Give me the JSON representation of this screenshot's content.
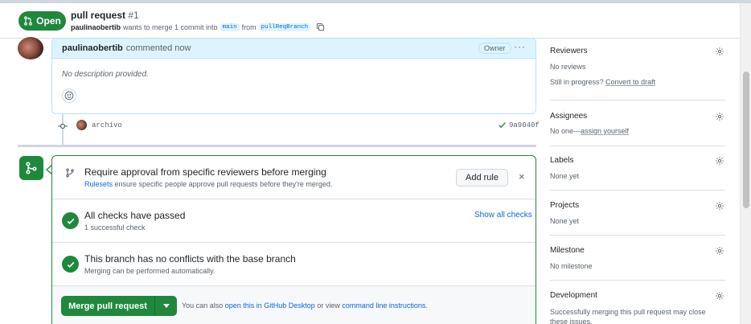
{
  "header": {
    "state": "Open",
    "title": "pull request",
    "number": "#1",
    "author": "paulinaobertib",
    "merge_text": "wants to merge 1 commit into",
    "base_branch": "main",
    "from_text": "from",
    "head_branch": "pullReqBranch"
  },
  "comment": {
    "author": "paulinaobertib",
    "action": "commented now",
    "badge": "Owner",
    "menu": "···",
    "body": "No description provided."
  },
  "commit": {
    "message": "archivo",
    "sha": "9a9040f"
  },
  "merge_box": {
    "rules": {
      "title": "Require approval from specific reviewers before merging",
      "link": "Rulesets",
      "description": "ensure specific people approve pull requests before they're merged.",
      "button": "Add rule",
      "close": "×"
    },
    "checks": {
      "title": "All checks have passed",
      "subtitle": "1 successful check",
      "link": "Show all checks"
    },
    "conflicts": {
      "title": "This branch has no conflicts with the base branch",
      "subtitle": "Merging can be performed automatically."
    },
    "merge": {
      "button": "Merge pull request",
      "hint_prefix": "You can also",
      "desktop_link": "open this in GitHub Desktop",
      "hint_mid": "or view",
      "cli_link": "command line instructions",
      "hint_suffix": "."
    }
  },
  "sidebar": {
    "reviewers": {
      "title": "Reviewers",
      "value": "No reviews",
      "progress_text": "Still in progress?",
      "progress_link": "Convert to draft"
    },
    "assignees": {
      "title": "Assignees",
      "value_prefix": "No one—",
      "value_link": "assign yourself"
    },
    "labels": {
      "title": "Labels",
      "value": "None yet"
    },
    "projects": {
      "title": "Projects",
      "value": "None yet"
    },
    "milestone": {
      "title": "Milestone",
      "value": "No milestone"
    },
    "development": {
      "title": "Development",
      "description": "Successfully merging this pull request may close these issues."
    }
  },
  "colors": {
    "success": "#1f883d",
    "accent": "#0969da",
    "comment_header": "#ddf4ff"
  },
  "icons": {
    "state": "git-pull-request-icon",
    "copy": "copy-icon",
    "merge": "git-merge-icon",
    "check": "check-icon",
    "gear": "gear-icon",
    "smiley": "smiley-icon"
  }
}
